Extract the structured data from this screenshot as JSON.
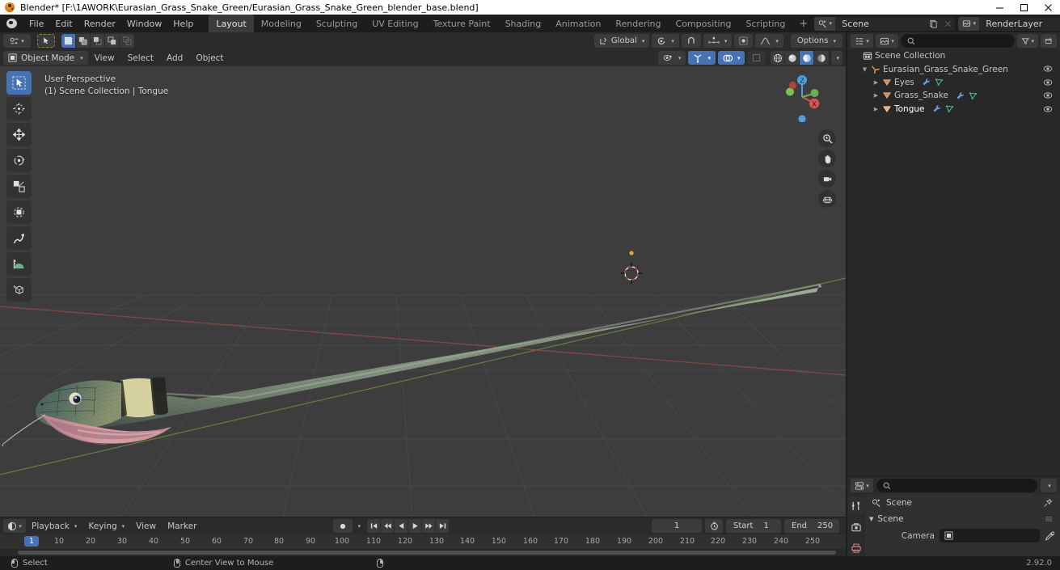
{
  "window": {
    "title": "Blender* [F:\\1AWORK\\Eurasian_Grass_Snake_Green/Eurasian_Grass_Snake_Green_blender_base.blend]",
    "app_icon": "blender-logo-icon",
    "minimize": "─",
    "maximize": "□",
    "close": "✕"
  },
  "topbar": {
    "logo": "blender-logo-icon",
    "menus": [
      "File",
      "Edit",
      "Render",
      "Window",
      "Help"
    ],
    "workspaces": [
      {
        "label": "Layout",
        "active": true
      },
      {
        "label": "Modeling",
        "active": false
      },
      {
        "label": "Sculpting",
        "active": false
      },
      {
        "label": "UV Editing",
        "active": false
      },
      {
        "label": "Texture Paint",
        "active": false
      },
      {
        "label": "Shading",
        "active": false
      },
      {
        "label": "Animation",
        "active": false
      },
      {
        "label": "Rendering",
        "active": false
      },
      {
        "label": "Compositing",
        "active": false
      },
      {
        "label": "Scripting",
        "active": false
      }
    ],
    "add_workspace": "+",
    "scene": {
      "icon": "scene-icon",
      "name": "Scene",
      "new_btn": "new-scene-icon",
      "unlink_btn": "✕"
    },
    "viewlayer": {
      "icon": "viewlayer-icon",
      "name": "RenderLayer",
      "new_btn": "new-layer-icon",
      "unlink_btn": "✕"
    }
  },
  "viewport_tool_header": {
    "editor_type": "editor-type-icon",
    "cursor_tool": "tweak-icon",
    "select_modes": [
      "set-new",
      "extend",
      "subtract",
      "invert",
      "intersect"
    ],
    "active_select_mode": 0,
    "transform_orientation": {
      "label": "Global",
      "icon": "orientation-icon"
    },
    "pivot": {
      "icon": "pivot-icon"
    },
    "snap": {
      "icon": "magnet-icon",
      "increment": "snap-increment-icon"
    },
    "proportional": {
      "icon": "proportional-icon",
      "falloff": "falloff-icon"
    },
    "options": "Options"
  },
  "viewport_mode_header": {
    "mode": "Object Mode",
    "mode_icon": "object-mode-icon",
    "menus": [
      "View",
      "Select",
      "Add",
      "Object"
    ],
    "visibility": "show-hide-icon",
    "gizmo": "gizmo-icon",
    "overlays": "overlays-icon",
    "xray": "xray-icon",
    "shading_modes": [
      "wireframe",
      "solid",
      "material-preview",
      "rendered"
    ],
    "active_shading": 2
  },
  "viewport": {
    "perspective": "User Perspective",
    "collection_info": "(1) Scene Collection | Tongue",
    "tools": [
      {
        "name": "tweak-select-box-tool",
        "active": true
      },
      {
        "name": "cursor-tool",
        "active": false
      },
      {
        "name": "move-tool",
        "active": false
      },
      {
        "name": "rotate-tool",
        "active": false
      },
      {
        "name": "scale-tool",
        "active": false
      },
      {
        "name": "transform-tool",
        "active": false
      },
      {
        "name": "annotate-tool",
        "active": false
      },
      {
        "name": "measure-tool",
        "active": false
      },
      {
        "name": "add-cube-tool",
        "active": false
      }
    ],
    "gizmo_axes": {
      "z": "Z",
      "x": "X",
      "y": "Y"
    },
    "nav_buttons": [
      "zoom-icon",
      "pan-hand-icon",
      "camera-view-icon",
      "toggle-ortho-icon"
    ],
    "colors": {
      "background": "#3d3d3d",
      "grid": "#4a4a4a",
      "axis_x_red": "#9c4c4c",
      "axis_y_green": "#7a9c4c",
      "snake_body": "#7e8c72",
      "snake_head": "#4e6b64",
      "snake_collar": "#e7e3ab",
      "tongue_pink": "#c08490"
    }
  },
  "outliner": {
    "header": {
      "display_mode": "outliner-display-mode-icon",
      "filter_id": "filter-id-icon",
      "search_placeholder": "",
      "search_value": "",
      "filter": "filter-funnel-icon",
      "new_collection": "new-collection-icon"
    },
    "rows": [
      {
        "label": "Scene Collection",
        "icon": "scene-collection-icon",
        "depth": 0,
        "disclosure": "",
        "selected": false,
        "eye": false,
        "extras": []
      },
      {
        "label": "Eurasian_Grass_Snake_Green",
        "icon": "armature-icon",
        "depth": 1,
        "disclosure": "▼",
        "selected": false,
        "eye": true,
        "extras": []
      },
      {
        "label": "Eyes",
        "icon": "mesh-data-icon",
        "depth": 2,
        "disclosure": "▶",
        "selected": false,
        "eye": true,
        "extras": [
          "modifier-icon",
          "mesh-triangle-icon"
        ]
      },
      {
        "label": "Grass_Snake",
        "icon": "mesh-data-icon",
        "depth": 2,
        "disclosure": "▶",
        "selected": false,
        "eye": true,
        "extras": [
          "modifier-icon",
          "mesh-triangle-icon"
        ]
      },
      {
        "label": "Tongue",
        "icon": "mesh-data-icon",
        "depth": 2,
        "disclosure": "▶",
        "selected": true,
        "eye": true,
        "extras": [
          "modifier-icon",
          "mesh-triangle-icon"
        ]
      }
    ]
  },
  "properties": {
    "header": {
      "editor_icon": "properties-editor-icon",
      "search_placeholder": "",
      "search_value": "",
      "options_caret": "⌄"
    },
    "tabs": [
      {
        "name": "tool-tab",
        "icon": "tool-icon",
        "active": true
      },
      {
        "name": "render-tab",
        "icon": "render-camera-icon",
        "active": false
      },
      {
        "name": "output-tab",
        "icon": "printer-icon",
        "active": false
      }
    ],
    "breadcrumb": {
      "icon": "scene-icon",
      "label": "Scene",
      "pin": "pin-icon"
    },
    "section": {
      "label": "Scene",
      "arrow": "▼",
      "grip": "grip-icon"
    },
    "camera_row": {
      "label": "Camera",
      "icon": "camera-object-icon",
      "value": "",
      "eyedropper": "eyedropper-icon"
    }
  },
  "timeline": {
    "editor_icon": "timeline-editor-icon",
    "menus": [
      "Playback",
      "Keying",
      "View",
      "Marker"
    ],
    "record_icon": "record-keyframe-icon",
    "transport": [
      "jump-start-icon",
      "prev-keyframe-icon",
      "play-reverse-icon",
      "play-icon",
      "next-keyframe-icon",
      "jump-end-icon"
    ],
    "current_frame": "1",
    "timer_icon": "timer-icon",
    "start_label": "Start",
    "start_value": "1",
    "end_label": "End",
    "end_value": "250",
    "ruler_ticks": [
      "1",
      "10",
      "20",
      "30",
      "40",
      "50",
      "60",
      "70",
      "80",
      "90",
      "100",
      "110",
      "120",
      "130",
      "140",
      "150",
      "160",
      "170",
      "180",
      "190",
      "200",
      "210",
      "220",
      "230",
      "240",
      "250"
    ],
    "current_tick_index": 0
  },
  "statusbar": {
    "items": [
      {
        "mouse": "left",
        "label": "Select"
      },
      {
        "mouse": "middle",
        "label": "Center View to Mouse"
      },
      {
        "mouse": "right",
        "label": ""
      }
    ],
    "version": "2.92.0"
  }
}
